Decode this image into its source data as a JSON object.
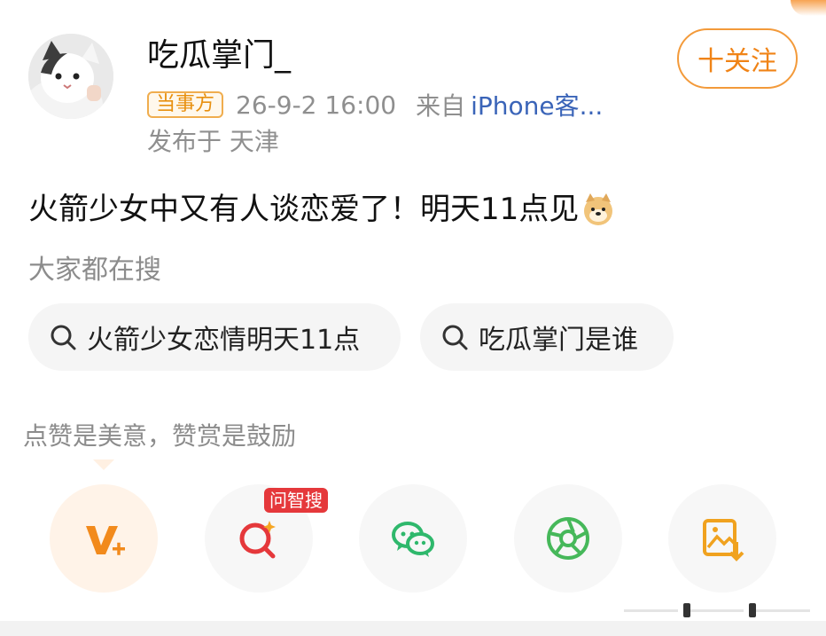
{
  "post": {
    "username": "吃瓜掌门_",
    "badge": "当事方",
    "time": "26-9-2 16:00",
    "from": "来自",
    "device": "iPhone客...",
    "location": "发布于 天津",
    "follow_label": "十关注",
    "content": "火箭少女中又有人谈恋爱了！明天11点见"
  },
  "search": {
    "title": "大家都在搜",
    "chips": [
      "火箭少女恋情明天11点",
      "吃瓜掌门是谁"
    ]
  },
  "support": {
    "tip": "点赞是美意，赞赏是鼓励"
  },
  "actions": {
    "ai_badge": "问智搜",
    "icons": [
      "reward-icon",
      "ai-search-icon",
      "wechat-icon",
      "moments-icon",
      "save-image-icon"
    ]
  },
  "colors": {
    "accent": "#f08316",
    "link": "#3a64b8",
    "ai_badge": "#e5383b"
  }
}
